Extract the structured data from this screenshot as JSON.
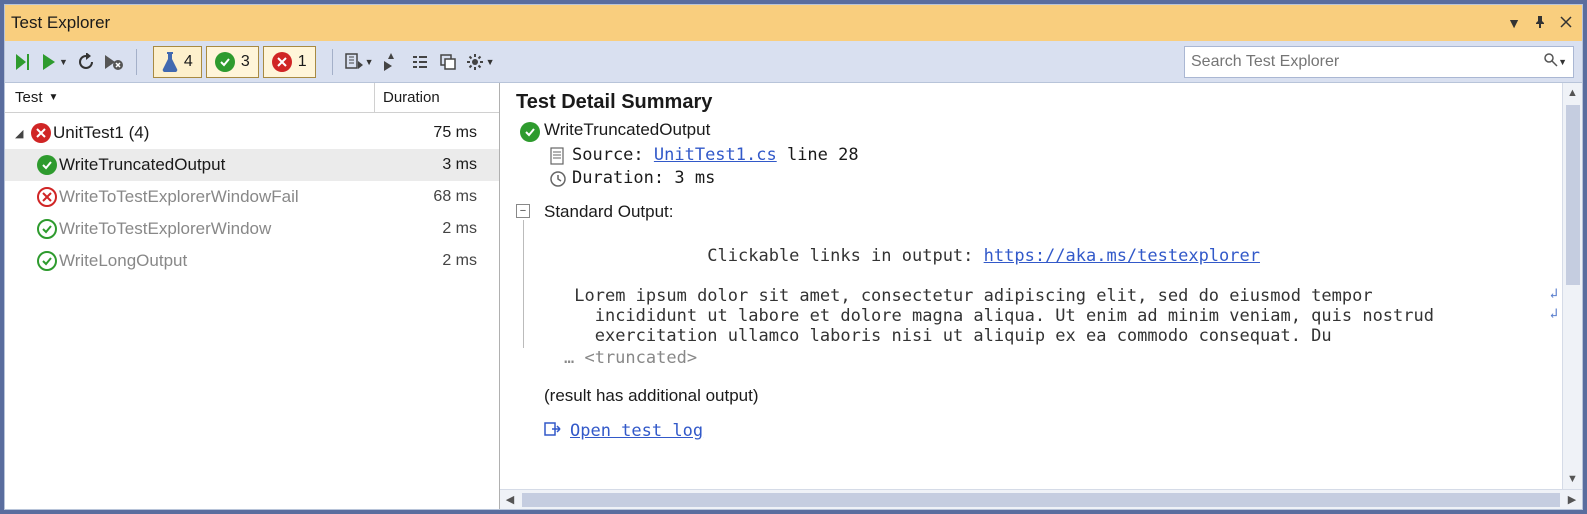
{
  "window": {
    "title": "Test Explorer"
  },
  "summary": {
    "total": "4",
    "passed": "3",
    "failed": "1"
  },
  "search": {
    "placeholder": "Search Test Explorer"
  },
  "columns": {
    "test": "Test",
    "duration": "Duration"
  },
  "tree": {
    "root": {
      "name": "UnitTest1",
      "count": "(4)",
      "duration": "75 ms"
    },
    "items": [
      {
        "name": "WriteTruncatedOutput",
        "duration": "3 ms",
        "status": "pass",
        "selected": true
      },
      {
        "name": "WriteToTestExplorerWindowFail",
        "duration": "68 ms",
        "status": "fail",
        "selected": false
      },
      {
        "name": "WriteToTestExplorerWindow",
        "duration": "2 ms",
        "status": "pass",
        "selected": false
      },
      {
        "name": "WriteLongOutput",
        "duration": "2 ms",
        "status": "pass",
        "selected": false
      }
    ]
  },
  "detail": {
    "heading": "Test Detail Summary",
    "test_name": "WriteTruncatedOutput",
    "source_label": "Source: ",
    "source_file": "UnitTest1.cs",
    "source_line": " line 28",
    "duration_label": "Duration: ",
    "duration_value": "3 ms",
    "std_heading": "Standard Output:",
    "out_line1_prefix": "Clickable links in output: ",
    "out_link": "https://aka.ms/testexplorer",
    "out_line2": " Lorem ipsum dolor sit amet, consectetur adipiscing elit, sed do eiusmod tempor",
    "out_line3": "   incididunt ut labore et dolore magna aliqua. Ut enim ad minim veniam, quis nostrud",
    "out_line4": "   exercitation ullamco laboris nisi ut aliquip ex ea commodo consequat. Du",
    "truncated": "… <truncated>",
    "additional": "(result has additional output)",
    "open_log": "Open test log"
  }
}
